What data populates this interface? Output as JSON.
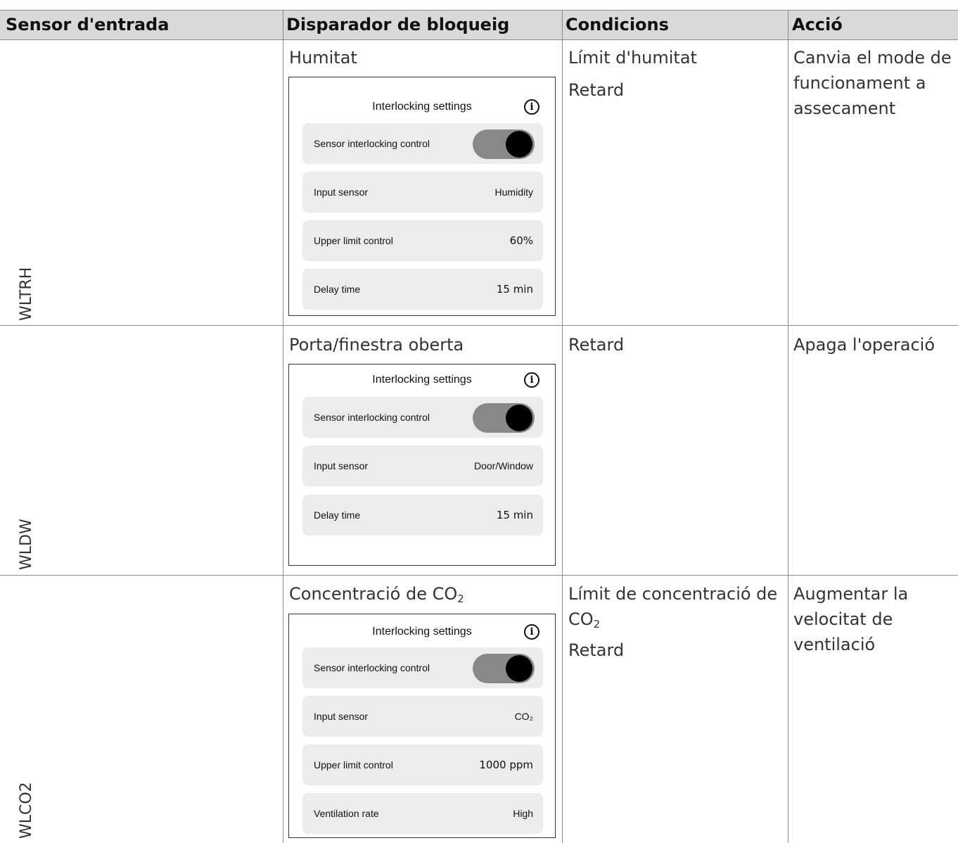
{
  "headers": [
    "Sensor d'entrada",
    "Disparador de bloqueig",
    "Condicions",
    "Acció"
  ],
  "rows": [
    {
      "sensor": "WLTRH",
      "trigger": "Humitat",
      "conditions": [
        "Límit d'humitat",
        "Retard"
      ],
      "action": "Canvia el mode de funcionament a assecament",
      "panel": {
        "title": "Interlocking settings",
        "toggle_label": "Sensor interlocking control",
        "toggle_on": true,
        "items": [
          {
            "label": "Input sensor",
            "value": "Humidity"
          },
          {
            "label": "Upper limit control",
            "value": "60%"
          },
          {
            "label": "Delay time",
            "value": "15 min"
          }
        ]
      }
    },
    {
      "sensor": "WLDW",
      "trigger": "Porta/finestra oberta",
      "conditions": [
        "Retard"
      ],
      "action": "Apaga l'operació",
      "panel": {
        "title": "Interlocking settings",
        "toggle_label": "Sensor interlocking control",
        "toggle_on": true,
        "items": [
          {
            "label": "Input sensor",
            "value": "Door/Window"
          },
          {
            "label": "Delay time",
            "value": "15 min"
          }
        ]
      }
    },
    {
      "sensor": "WLCO2",
      "trigger_text": "Concentració de CO",
      "trigger_sub": "2",
      "condition_line1": "Límit de concentració de",
      "condition_co": "CO",
      "condition_sub": "2",
      "condition_line3": "Retard",
      "action": "Augmentar la velocitat de ventilació",
      "panel": {
        "title": "Interlocking settings",
        "toggle_label": "Sensor interlocking control",
        "toggle_on": true,
        "items": [
          {
            "label": "Input sensor",
            "value": "CO₂"
          },
          {
            "label": "Upper limit control",
            "value": "1000 ppm"
          },
          {
            "label": "Ventilation rate",
            "value": "High"
          }
        ]
      }
    }
  ]
}
